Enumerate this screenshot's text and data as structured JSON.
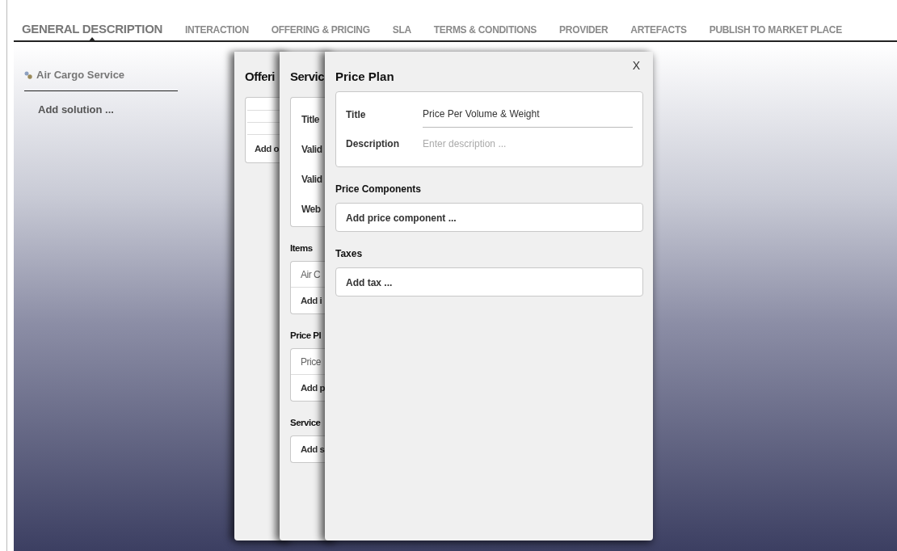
{
  "tabs": [
    {
      "label": "GENERAL DESCRIPTION",
      "selected": true
    },
    {
      "label": "INTERACTION",
      "selected": false
    },
    {
      "label": "OFFERING & PRICING",
      "selected": false
    },
    {
      "label": "SLA",
      "selected": false
    },
    {
      "label": "TERMS & CONDITIONS",
      "selected": false
    },
    {
      "label": "PROVIDER",
      "selected": false
    },
    {
      "label": "ARTEFACTS",
      "selected": false
    },
    {
      "label": "PUBLISH TO MARKET PLACE",
      "selected": false
    }
  ],
  "sidebar": {
    "solution": "Air Cargo Service",
    "add": "Add solution ..."
  },
  "offering_panel": {
    "title": "Offeri",
    "add": "Add o"
  },
  "service_panel": {
    "title": "Servic",
    "fields": [
      "Title",
      "Valid",
      "Valid",
      "Web"
    ],
    "sections": [
      {
        "title": "Items",
        "items": [
          "Air C"
        ],
        "add": "Add i"
      },
      {
        "title": "Price Pl",
        "items": [
          "Price"
        ],
        "add": "Add p"
      },
      {
        "title": "Service",
        "add": "Add s"
      }
    ]
  },
  "price_plan": {
    "title": "Price Plan",
    "close": "X",
    "fields": [
      {
        "label": "Title",
        "value": "Price Per Volume & Weight"
      },
      {
        "label": "Description",
        "placeholder": "Enter description ..."
      }
    ],
    "sections": [
      {
        "title": "Price Components",
        "add": "Add price component ..."
      },
      {
        "title": "Taxes",
        "add": "Add tax ..."
      }
    ]
  }
}
